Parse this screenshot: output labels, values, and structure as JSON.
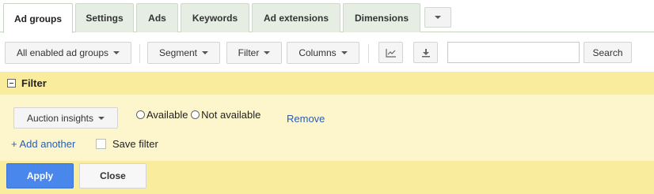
{
  "tabs": [
    {
      "label": "Ad groups",
      "active": true
    },
    {
      "label": "Settings"
    },
    {
      "label": "Ads"
    },
    {
      "label": "Keywords"
    },
    {
      "label": "Ad extensions"
    },
    {
      "label": "Dimensions"
    }
  ],
  "toolbar": {
    "status_filter": "All enabled ad groups",
    "segment": "Segment",
    "filter": "Filter",
    "columns": "Columns",
    "chart_icon": "line-chart-icon",
    "download_icon": "download-icon",
    "search_value": "",
    "search_button": "Search"
  },
  "filter_panel": {
    "title": "Filter",
    "condition_select": "Auction insights",
    "options": [
      "Available",
      "Not available"
    ],
    "remove": "Remove",
    "add_another": "+ Add another",
    "save_filter": "Save filter",
    "apply": "Apply",
    "close": "Close"
  },
  "colors": {
    "accent_blue": "#4a87ec",
    "link_blue": "#2a5db0",
    "filter_header_bg": "#f9ed9d",
    "filter_body_bg": "#fdf6cd",
    "tab_bg": "#e6ede3"
  }
}
